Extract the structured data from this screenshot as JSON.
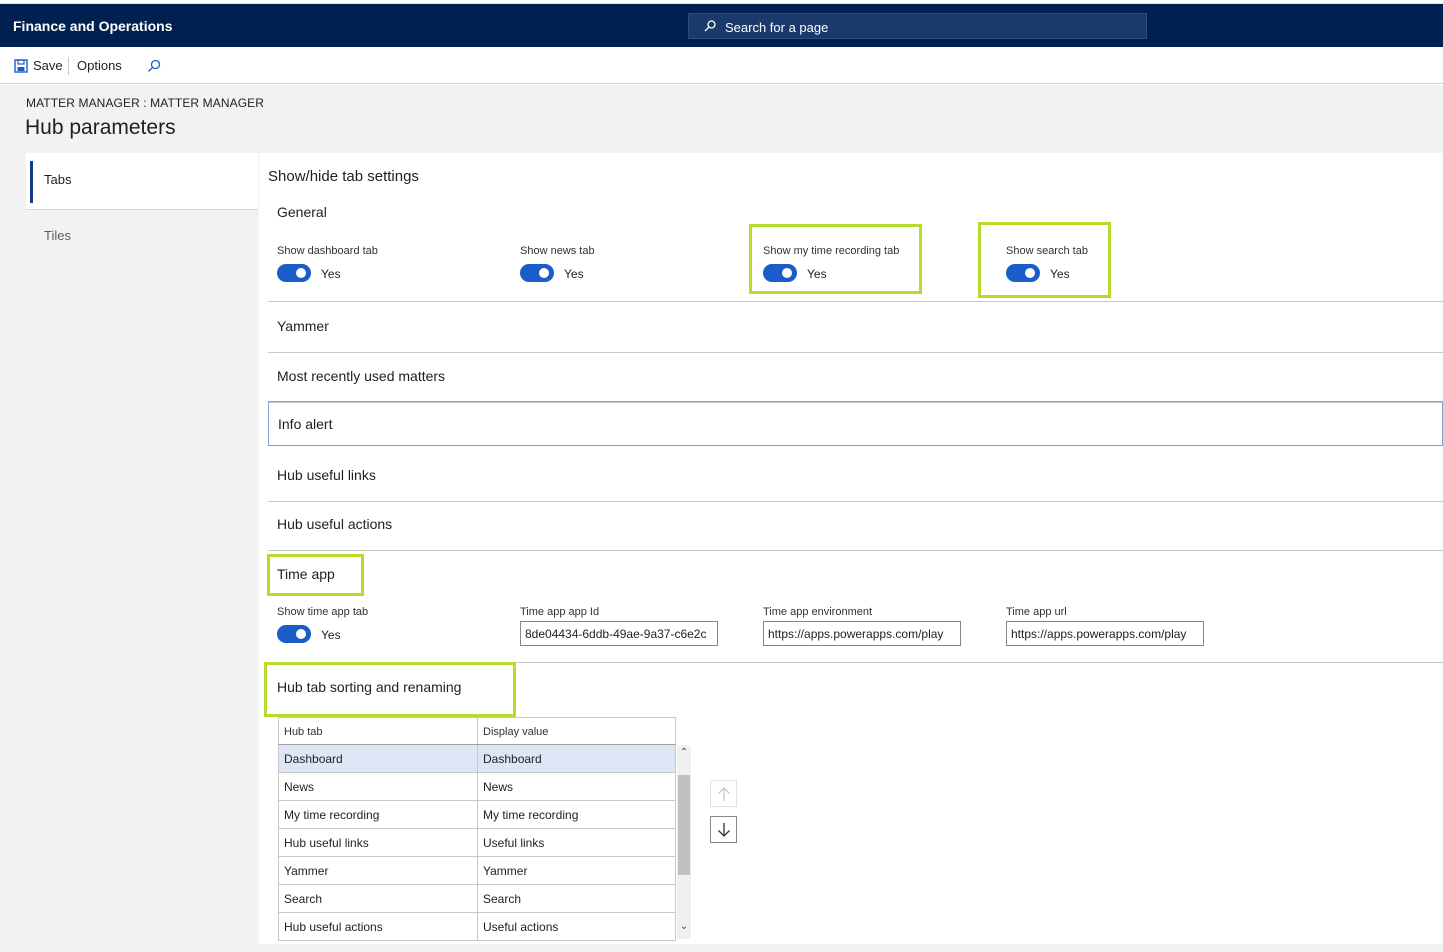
{
  "app": {
    "title": "Finance and Operations"
  },
  "search": {
    "placeholder": "Search for a page"
  },
  "toolbar": {
    "save_label": "Save",
    "options_label": "Options"
  },
  "breadcrumb": "MATTER MANAGER : MATTER MANAGER",
  "page_title": "Hub parameters",
  "nav": {
    "items": [
      {
        "label": "Tabs",
        "selected": true
      },
      {
        "label": "Tiles",
        "selected": false
      }
    ]
  },
  "content_heading": "Show/hide tab settings",
  "general": {
    "title": "General",
    "toggles": [
      {
        "label": "Show dashboard tab",
        "value": "Yes"
      },
      {
        "label": "Show news tab",
        "value": "Yes"
      },
      {
        "label": "Show my time recording tab",
        "value": "Yes"
      },
      {
        "label": "Show search tab",
        "value": "Yes"
      }
    ]
  },
  "sections": [
    "Yammer",
    "Most recently used matters",
    "Info alert",
    "Hub useful links",
    "Hub useful actions"
  ],
  "time_app": {
    "title": "Time app",
    "toggle": {
      "label": "Show time app tab",
      "value": "Yes"
    },
    "app_id": {
      "label": "Time app app Id",
      "value": "8de04434-6ddb-49ae-9a37-c6e2c"
    },
    "environment": {
      "label": "Time app environment",
      "value": "https://apps.powerapps.com/play"
    },
    "url": {
      "label": "Time app url",
      "value": "https://apps.powerapps.com/play"
    }
  },
  "sorting": {
    "title": "Hub tab sorting and renaming",
    "columns": [
      "Hub tab",
      "Display value"
    ],
    "rows": [
      [
        "Dashboard",
        "Dashboard"
      ],
      [
        "News",
        "News"
      ],
      [
        "My time recording",
        "My time recording"
      ],
      [
        "Hub useful links",
        "Useful links"
      ],
      [
        "Yammer",
        "Yammer"
      ],
      [
        "Search",
        "Search"
      ],
      [
        "Hub useful actions",
        "Useful actions"
      ]
    ]
  },
  "colors": {
    "app_bar": "#002050",
    "toggle_on": "#1a5dc8",
    "highlight": "#b5dc2b",
    "selected_row": "#dde6f5"
  },
  "icons": [
    "search-icon",
    "save-icon",
    "find-icon",
    "arrow-up-icon",
    "arrow-down-icon"
  ]
}
